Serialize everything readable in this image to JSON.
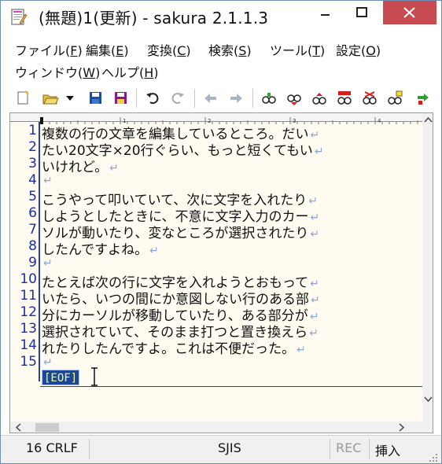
{
  "window": {
    "title": "(無題)1(更新) - sakura 2.1.1.3",
    "icon": "document-pencil-icon",
    "controls": [
      "minimize-icon",
      "maximize-icon",
      "close-icon"
    ],
    "colors": {
      "close_bg": "#c74b50",
      "line_number": "#1a2ea8",
      "eof_bg": "#1e4696",
      "eof_text": "#e8ff9a",
      "editor_bg": "#fffbf0",
      "return_mark": "#8aa7d8"
    }
  },
  "menu": {
    "items": [
      {
        "label": "ファイル(",
        "key": "F",
        "tail": ")"
      },
      {
        "label": "編集(",
        "key": "E",
        "tail": ")"
      },
      {
        "label": "変換(",
        "key": "C",
        "tail": ")"
      },
      {
        "label": "検索(",
        "key": "S",
        "tail": ")"
      },
      {
        "label": "ツール(",
        "key": "T",
        "tail": ")"
      },
      {
        "label": "設定(",
        "key": "O",
        "tail": ")"
      },
      {
        "label": "ウィンドウ(",
        "key": "W",
        "tail": ")"
      },
      {
        "label": "ヘルプ(",
        "key": "H",
        "tail": ")"
      }
    ]
  },
  "toolbar": {
    "icons": [
      "new-file-icon",
      "open-folder-icon",
      "dropdown-icon",
      "save-icon",
      "save-all-icon",
      "undo-icon",
      "redo-icon",
      "jump-back-icon",
      "jump-forward-icon",
      "grep-search-icon",
      "search-next-icon",
      "search-prev-icon",
      "replace-icon",
      "clear-mark-icon",
      "search-highlight-icon",
      "bookmark-next-icon"
    ]
  },
  "editor": {
    "line_numbers": [
      "1",
      "2",
      "3",
      "4",
      "5",
      "6",
      "7",
      "8",
      "9",
      "10",
      "11",
      "12",
      "13",
      "14",
      "15"
    ],
    "lines": [
      "複数の行の文章を編集しているところ。だい",
      "たい20文字×20行ぐらい、もっと短くてもい",
      "いけれど。",
      "",
      "こうやって叩いていて、次に文字を入れたり",
      "しようとしたときに、不意に文字入力のカー",
      "ソルが動いたり、変なところが選択されたり",
      "したんですよね。",
      "",
      "たとえば次の行に文字を入れようとおもって",
      "いたら、いつの間にか意図しない行のある部",
      "分にカーソルが移動していたり、ある部分が",
      "選択されていて、そのまま打つと置き換えら",
      "れたりしたんですよ。これは不便だった。",
      ""
    ],
    "return_mark": "↵",
    "eof_label": "[EOF]",
    "ruler_marks": [
      "1",
      "1",
      "2",
      "3",
      "4"
    ]
  },
  "status": {
    "position": "16 CRLF",
    "encoding": "SJIS",
    "rec": "REC",
    "mode": "挿入"
  }
}
